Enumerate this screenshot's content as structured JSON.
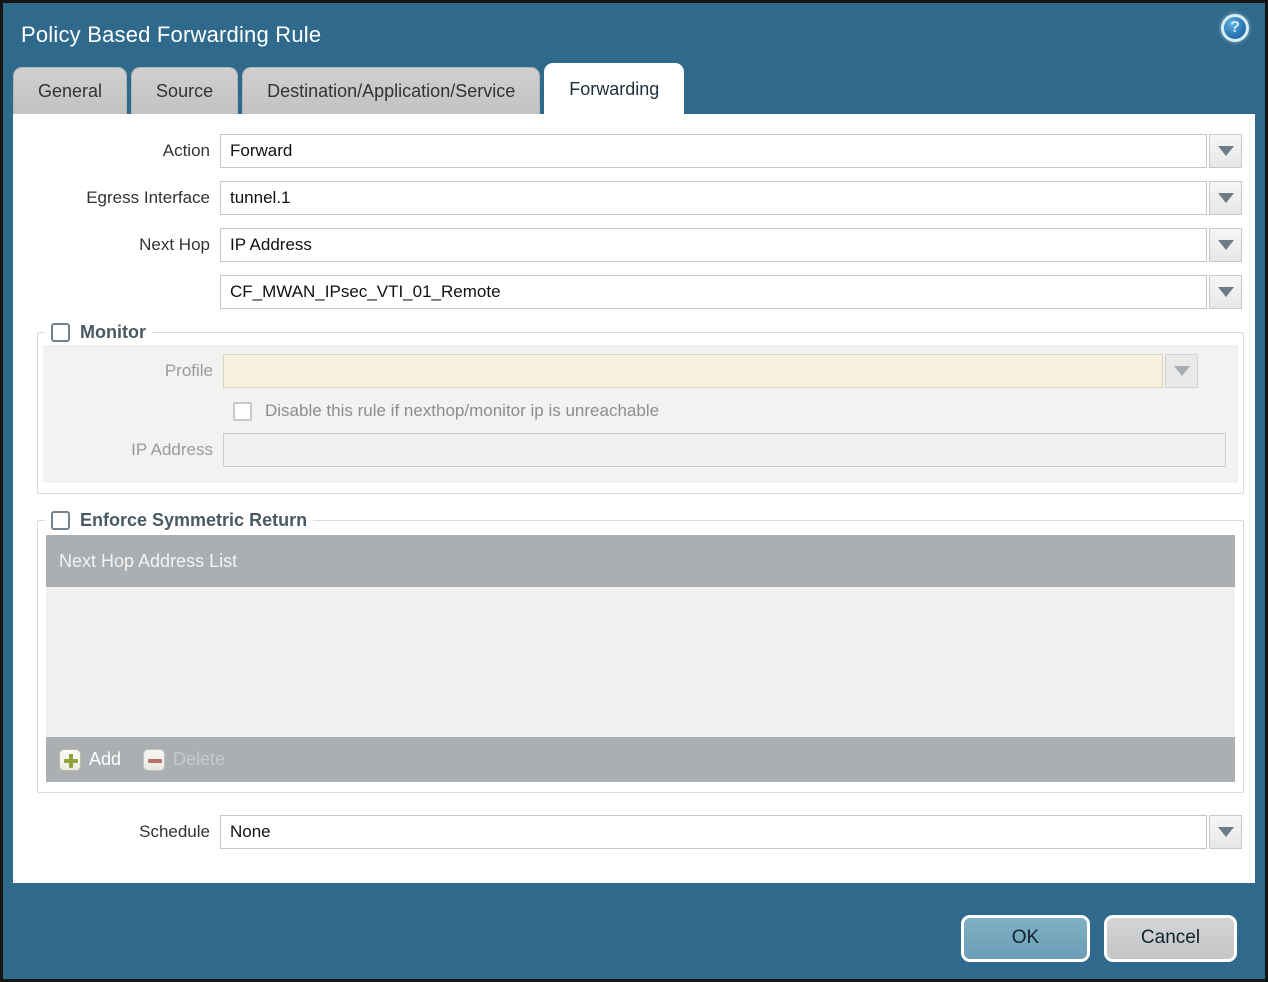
{
  "window": {
    "title": "Policy Based Forwarding Rule",
    "help_glyph": "?"
  },
  "tabs": [
    {
      "label": "General",
      "active": false
    },
    {
      "label": "Source",
      "active": false
    },
    {
      "label": "Destination/Application/Service",
      "active": false
    },
    {
      "label": "Forwarding",
      "active": true
    }
  ],
  "form": {
    "action_label": "Action",
    "action_value": "Forward",
    "egress_label": "Egress Interface",
    "egress_value": "tunnel.1",
    "next_hop_label": "Next Hop",
    "next_hop_value": "IP Address",
    "next_hop_address_value": "CF_MWAN_IPsec_VTI_01_Remote",
    "schedule_label": "Schedule",
    "schedule_value": "None"
  },
  "monitor": {
    "legend": "Monitor",
    "checked": false,
    "profile_label": "Profile",
    "profile_value": "",
    "disable_rule_label": "Disable this rule if nexthop/monitor ip is unreachable",
    "disable_rule_checked": false,
    "ip_label": "IP Address",
    "ip_value": ""
  },
  "symmetric": {
    "legend": "Enforce Symmetric Return",
    "checked": false,
    "table_header": "Next Hop Address List",
    "rows": [],
    "add_label": "Add",
    "delete_label": "Delete"
  },
  "footer": {
    "ok_label": "OK",
    "cancel_label": "Cancel"
  },
  "colors": {
    "titlebar_teal": "#2F6A8C",
    "tab_inactive_gray": "#C7C7C7",
    "disabled_field_beige": "#F6F0DD",
    "table_header_gray": "#ABAFB2",
    "ok_button_blue": "#74A7BD",
    "cancel_button_gray": "#C9CBCD",
    "add_plus_green": "#8FA33B",
    "delete_minus_red": "#B5746A"
  }
}
